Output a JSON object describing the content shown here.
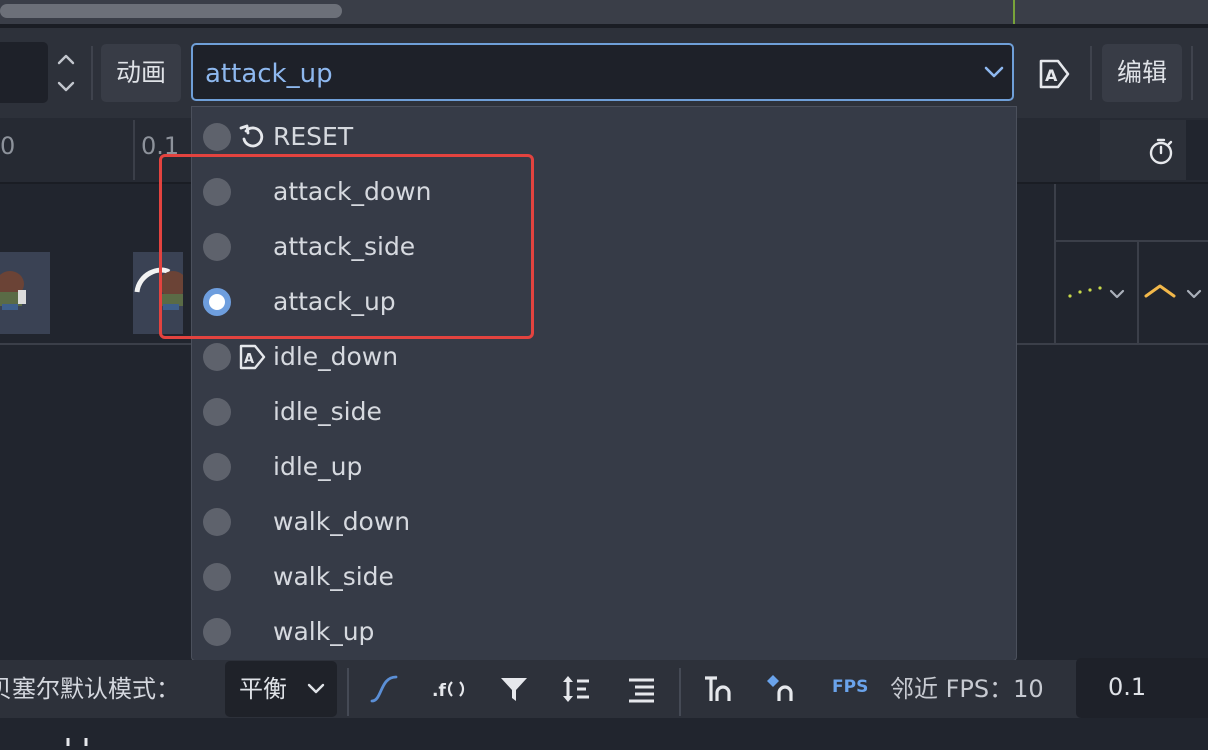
{
  "toolbar": {
    "animation_label": "动画",
    "selected_animation": "attack_up",
    "edit_label": "编辑",
    "spin_up_icon": "chevron-up-icon",
    "spin_down_icon": "chevron-down-icon",
    "autoplay_icon": "autoplay-icon"
  },
  "timeline": {
    "ticks": [
      "0",
      "0.1"
    ],
    "timer_icon": "stopwatch-icon"
  },
  "dropdown": {
    "items": [
      {
        "label": "RESET",
        "icon": "reset-icon",
        "checked": false
      },
      {
        "label": "attack_down",
        "icon": "",
        "checked": false
      },
      {
        "label": "attack_side",
        "icon": "",
        "checked": false
      },
      {
        "label": "attack_up",
        "icon": "",
        "checked": true
      },
      {
        "label": "idle_down",
        "icon": "autoplay-icon",
        "checked": false
      },
      {
        "label": "idle_side",
        "icon": "",
        "checked": false
      },
      {
        "label": "idle_up",
        "icon": "",
        "checked": false
      },
      {
        "label": "walk_down",
        "icon": "",
        "checked": false
      },
      {
        "label": "walk_side",
        "icon": "",
        "checked": false
      },
      {
        "label": "walk_up",
        "icon": "",
        "checked": false
      }
    ]
  },
  "bottom": {
    "bezier_label": "贝塞尔默认模式：",
    "balance_value": "平衡",
    "fps_badge": "FPS",
    "snap_label": "邻近 FPS：10",
    "snap_value": "0.1"
  },
  "colors": {
    "accent": "#6f9fd8",
    "highlight_box": "#e3433f",
    "background": "#21252e"
  }
}
